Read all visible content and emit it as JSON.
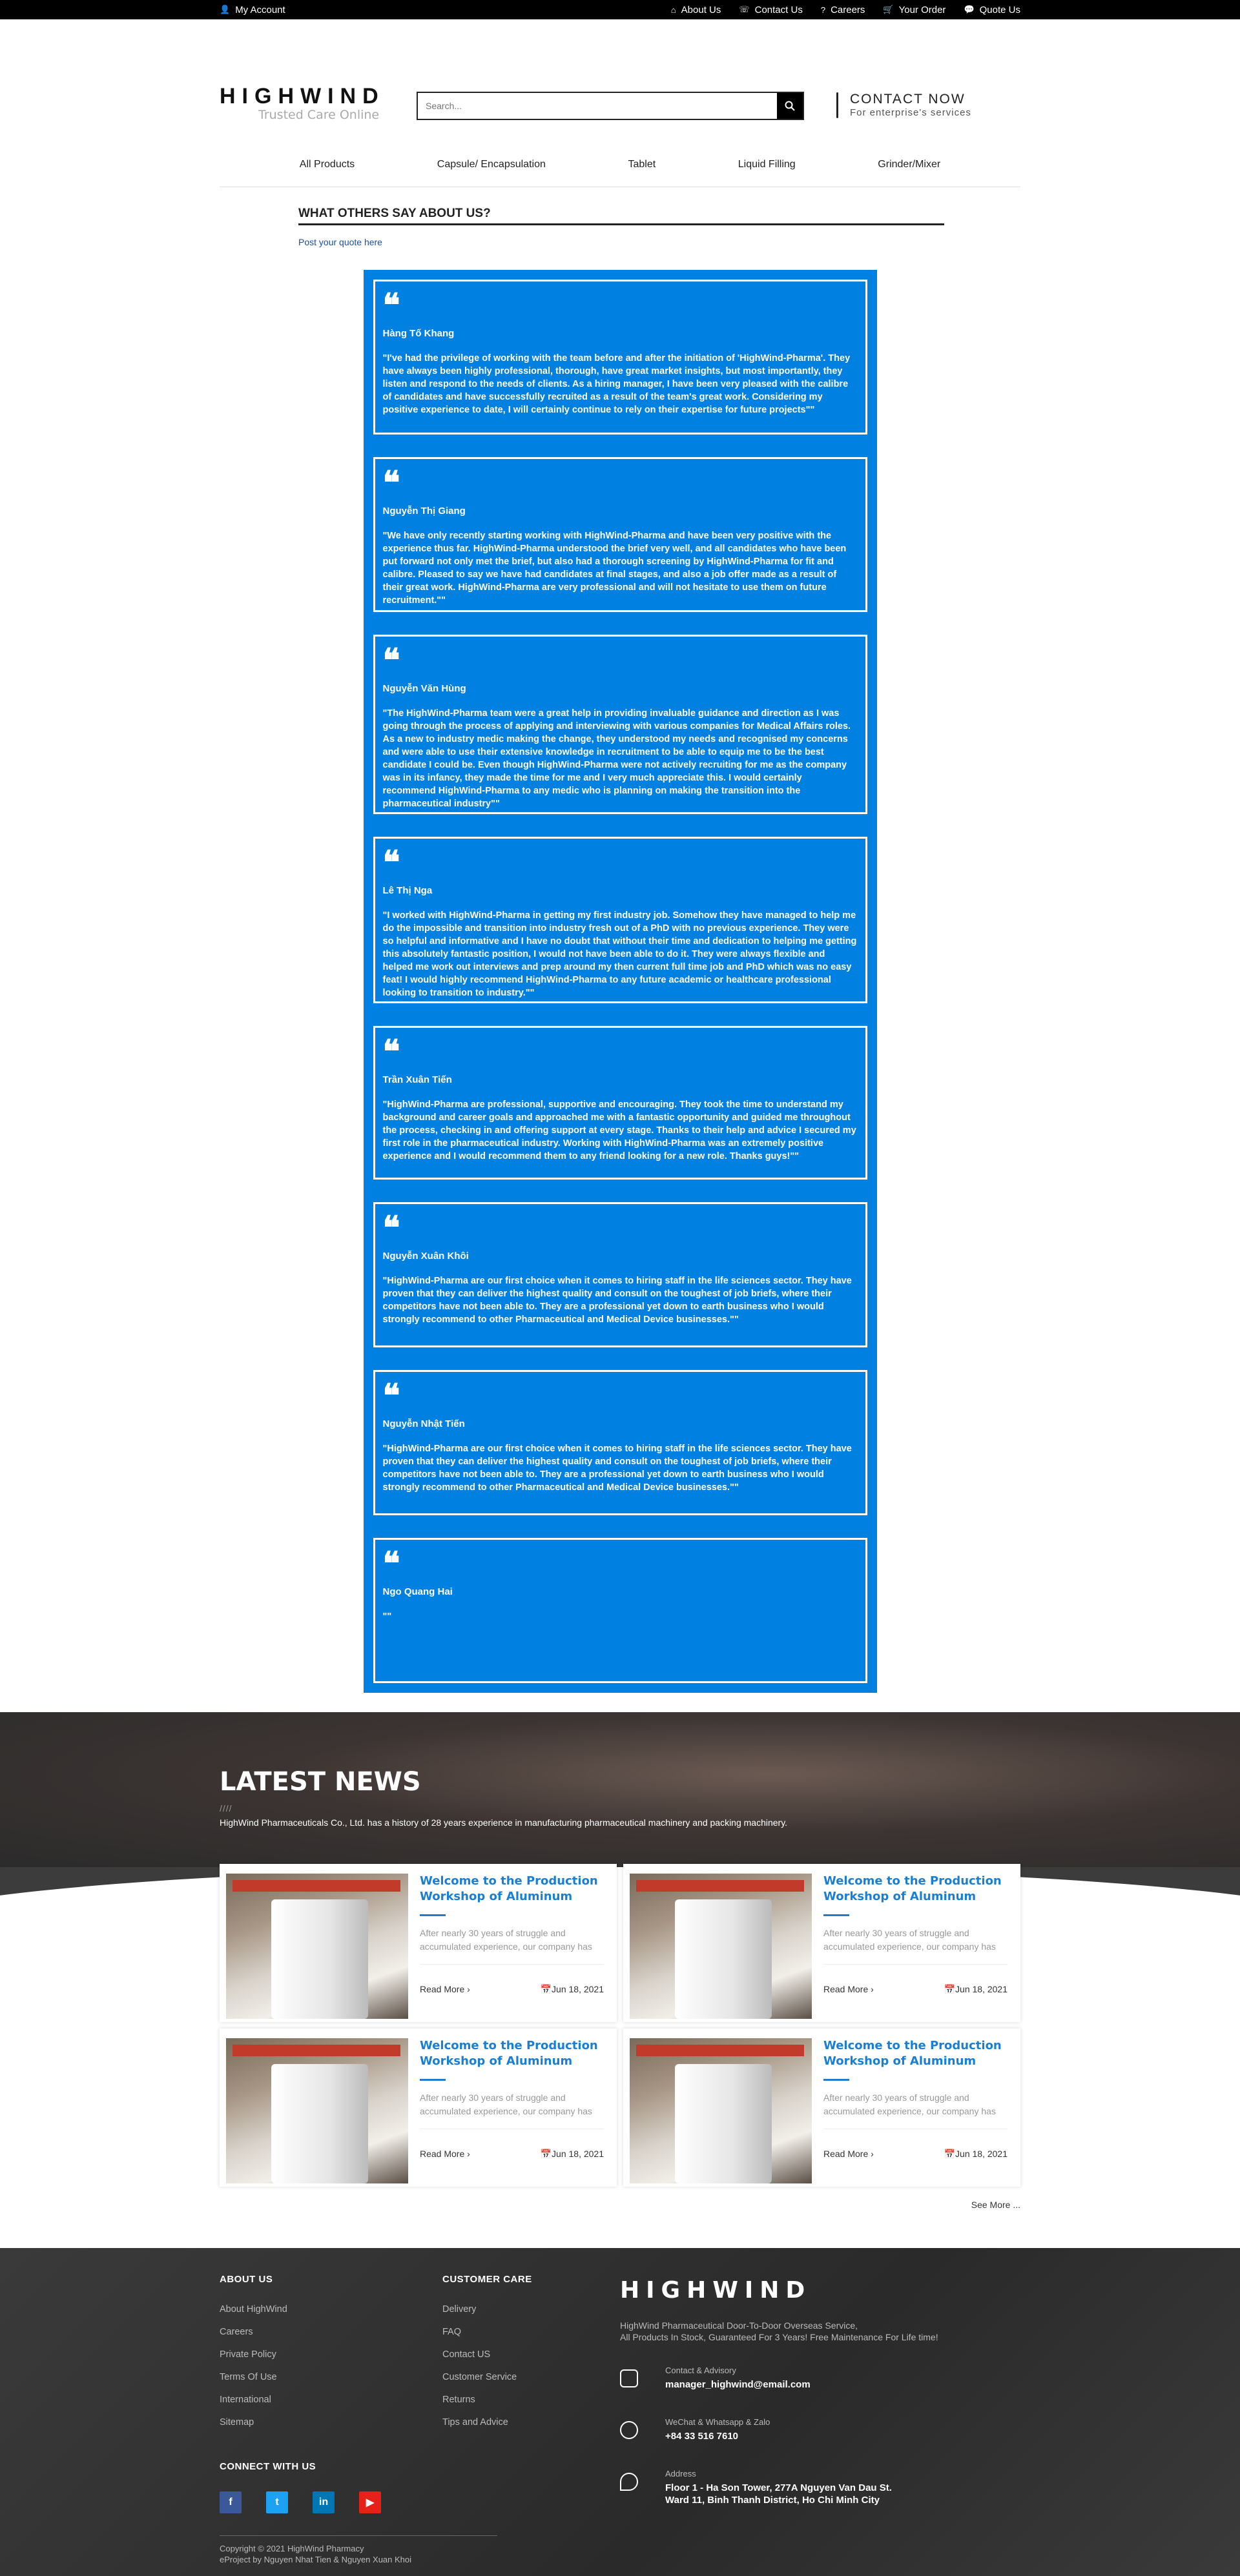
{
  "topbar": {
    "account": "My Account",
    "links": [
      "About Us",
      "Contact Us",
      "Careers",
      "Your Order",
      "Quote Us"
    ]
  },
  "header": {
    "brand": "HIGHWIND",
    "tagline": "Trusted Care Online",
    "search_placeholder": "Search...",
    "contact_title": "CONTACT NOW",
    "contact_sub": "For enterprise's services"
  },
  "nav": [
    "All Products",
    "Capsule/ Encapsulation",
    "Tablet",
    "Liquid Filling",
    "Grinder/Mixer"
  ],
  "testimonials": {
    "heading": "WHAT OTHERS SAY ABOUT US?",
    "post_link": "Post your quote here",
    "items": [
      {
        "name": "Hàng Tố Khang",
        "text": "\"I've had the privilege of working with the team before and after the initiation of 'HighWind-Pharma'. They have always been highly professional, thorough, have great market insights, but most importantly, they listen and respond to the needs of clients. As a hiring manager, I have been very pleased with the calibre of candidates and have successfully recruited as a result of the team's great work. Considering my positive experience to date, I will certainly continue to rely on their expertise for future projects\"\""
      },
      {
        "name": "Nguyễn Thị Giang",
        "text": "\"We have only recently starting working with HighWind-Pharma and have been very positive with the experience thus far. HighWind-Pharma understood the brief very well, and all candidates who have been put forward not only met the brief, but also had a thorough screening by HighWind-Pharma for fit and calibre. Pleased to say we have had candidates at final stages, and also a job offer made as a result of their great work. HighWind-Pharma are very professional and will not hesitate to use them on future recruitment.\"\""
      },
      {
        "name": "Nguyễn Văn Hùng",
        "text": "\"The HighWind-Pharma team were a great help in providing invaluable guidance and direction as I was going through the process of applying and interviewing with various companies for Medical Affairs roles. As a new to industry medic making the change, they understood my needs and recognised my concerns and were able to use their extensive knowledge in recruitment to be able to equip me to be the best candidate I could be. Even though HighWind-Pharma were not actively recruiting for me as the company was in its infancy, they made the time for me and I very much appreciate this. I would certainly recommend HighWind-Pharma to any medic who is planning on making the transition into the pharmaceutical industry\"\""
      },
      {
        "name": "Lê Thị Nga",
        "text": "\"I worked with HighWind-Pharma in getting my first industry job. Somehow they have managed to help me do the impossible and transition into industry fresh out of a PhD with no previous experience. They were so helpful and informative and I have no doubt that without their time and dedication to helping me getting this absolutely fantastic position, I would not have been able to do it. They were always flexible and helped me work out interviews and prep around my then current full time job and PhD which was no easy feat! I would highly recommend HighWind-Pharma to any future academic or healthcare professional looking to transition to industry.\"\""
      },
      {
        "name": "Trần Xuân Tiến",
        "text": "\"HighWind-Pharma are professional, supportive and encouraging. They took the time to understand my background and career goals and approached me with a fantastic opportunity and guided me throughout the process, checking in and offering support at every stage. Thanks to their help and advice I secured my first role in the pharmaceutical industry. Working with HighWind-Pharma was an extremely positive experience and I would recommend them to any friend looking for a new role. Thanks guys!\"\""
      },
      {
        "name": "Nguyễn Xuân Khôi",
        "text": "\"HighWind-Pharma are our first choice when it comes to hiring staff in the life sciences sector. They have proven that they can deliver the highest quality and consult on the toughest of job briefs, where their competitors have not been able to. They are a professional yet down to earth business who I would strongly recommend to other Pharmaceutical and Medical Device businesses.\"\""
      },
      {
        "name": "Nguyễn Nhật Tiến",
        "text": "\"HighWind-Pharma are our first choice when it comes to hiring staff in the life sciences sector. They have proven that they can deliver the highest quality and consult on the toughest of job briefs, where their competitors have not been able to. They are a professional yet down to earth business who I would strongly recommend to other Pharmaceutical and Medical Device businesses.\"\""
      },
      {
        "name": "Ngo Quang Hai",
        "text": "\"\""
      }
    ]
  },
  "news": {
    "heading": "LATEST NEWS",
    "slash": "////",
    "description": "HighWind Pharmaceuticals Co., Ltd. has a history of 28 years experience in manufacturing pharmaceutical machinery and packing machinery.",
    "items": [
      {
        "title": "Welcome to the Production Workshop of Aluminum",
        "excerpt": "After nearly 30 years of struggle and accumulated experience, our company has",
        "read_more": "Read More ›",
        "date": "Jun 18, 2021"
      },
      {
        "title": "Welcome to the Production Workshop of Aluminum",
        "excerpt": "After nearly 30 years of struggle and accumulated experience, our company has",
        "read_more": "Read More ›",
        "date": "Jun 18, 2021"
      },
      {
        "title": "Welcome to the Production Workshop of Aluminum",
        "excerpt": "After nearly 30 years of struggle and accumulated experience, our company has",
        "read_more": "Read More ›",
        "date": "Jun 18, 2021"
      },
      {
        "title": "Welcome to the Production Workshop of Aluminum",
        "excerpt": "After nearly 30 years of struggle and accumulated experience, our company has",
        "read_more": "Read More ›",
        "date": "Jun 18, 2021"
      }
    ],
    "see_more": "See More ..."
  },
  "footer": {
    "about_heading": "ABOUT US",
    "about_links": [
      "About HighWind",
      "Careers",
      "Private Policy",
      "Terms Of Use",
      "International",
      "Sitemap"
    ],
    "care_heading": "CUSTOMER CARE",
    "care_links": [
      "Delivery",
      "FAQ",
      "Contact US",
      "Customer Service",
      "Returns",
      "Tips and Advice"
    ],
    "connect_heading": "CONNECT WITH US",
    "social": [
      "f",
      "t",
      "in",
      "▶"
    ],
    "brand": "HIGHWIND",
    "brand_sub1": "HighWind Pharmaceutical Door-To-Door Overseas Service,",
    "brand_sub2": "All Products In Stock, Guaranteed For 3 Years! Free Maintenance For Life time!",
    "contact_label": "Contact & Advisory",
    "contact_value": "manager_highwind@email.com",
    "phone_label": "WeChat & Whatsapp & Zalo",
    "phone_value": "+84 33 516 7610",
    "address_label": "Address",
    "address_line1": "Floor 1 - Ha Son Tower, 277A Nguyen Van Dau St.",
    "address_line2": "Ward 11, Binh Thanh District, Ho Chi Minh City",
    "copyright": "Copyright © 2021 HighWind Pharmacy",
    "credit": "eProject by Nguyen Nhat Tien & Nguyen Xuan Khoi"
  }
}
